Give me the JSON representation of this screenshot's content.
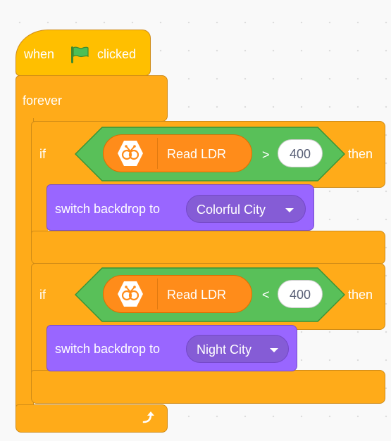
{
  "hat_block": {
    "when": "when",
    "clicked": "clicked",
    "icon": "green-flag-icon"
  },
  "forever_block": {
    "label": "forever",
    "loop_icon": "loop-arrow-icon"
  },
  "if_blocks": [
    {
      "if_label": "if",
      "then_label": "then",
      "reporter_label": "Read LDR",
      "reporter_icon": "extension-icon",
      "operator": ">",
      "value": "400",
      "action_label": "switch backdrop to",
      "backdrop": "Colorful City"
    },
    {
      "if_label": "if",
      "then_label": "then",
      "reporter_label": "Read LDR",
      "reporter_icon": "extension-icon",
      "operator": "<",
      "value": "400",
      "action_label": "switch backdrop to",
      "backdrop": "Night City"
    }
  ],
  "colors": {
    "events": "#ffbf00",
    "control": "#ffab19",
    "looks": "#9966ff",
    "operators": "#59c059",
    "extension": "#ff8c1a"
  }
}
